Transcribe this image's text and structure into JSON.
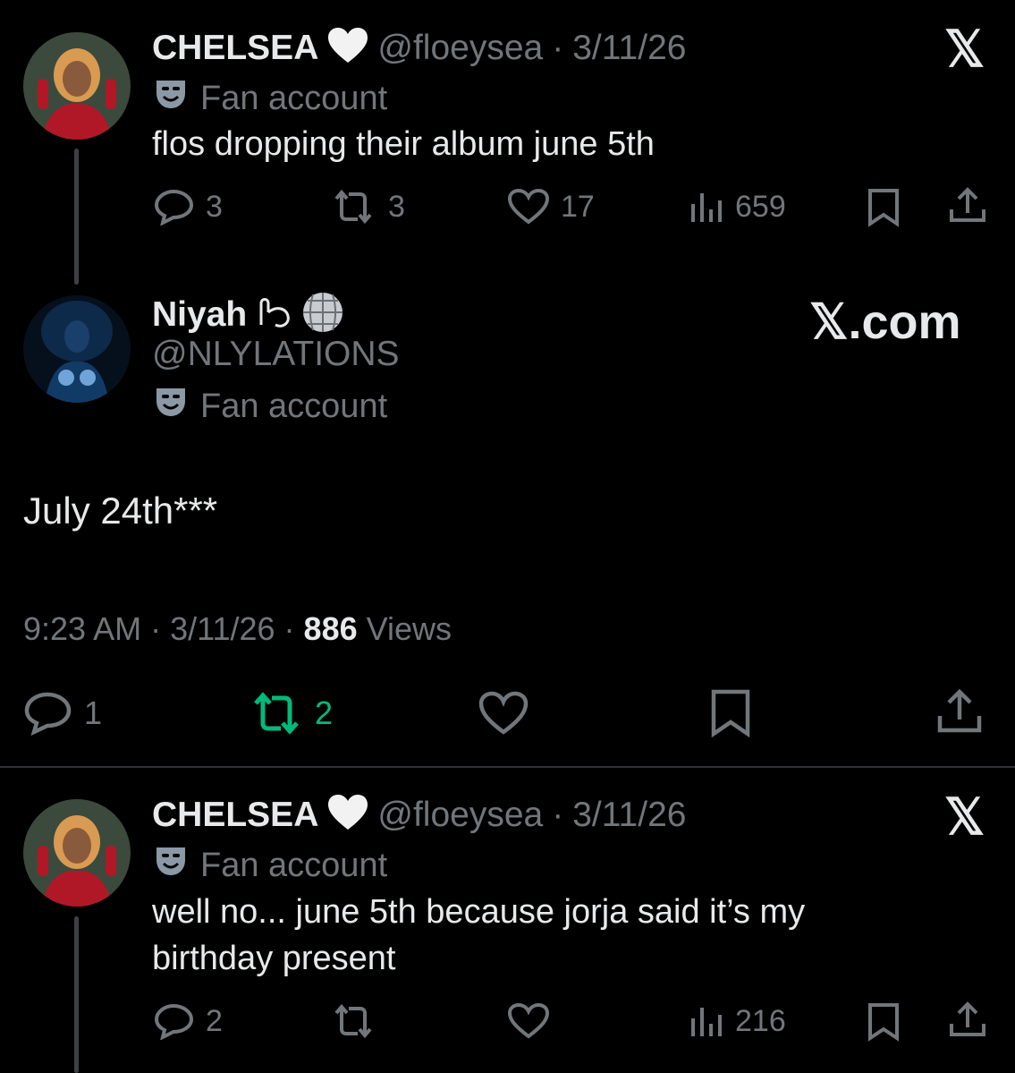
{
  "tweet1": {
    "display_name": "CHELSEA",
    "name_emoji": "white-heart",
    "handle": "@floeysea",
    "separator": "·",
    "date": "3/11/26",
    "badge": "Fan account",
    "text": "flos dropping their album june 5th",
    "replies": "3",
    "retweets": "3",
    "likes": "17",
    "views": "659"
  },
  "main_tweet": {
    "display_name": "Niyah",
    "name_emoji": "wave-and-disco-ball",
    "handle": "@NLYLATIONS",
    "badge": "Fan account",
    "text": "July 24th***",
    "time": "9:23 AM",
    "sep1": "·",
    "date": "3/11/26",
    "sep2": "·",
    "views_count": "886",
    "views_label": "Views",
    "replies": "1",
    "retweets": "2",
    "watermark": "𝕏.com"
  },
  "tweet3": {
    "display_name": "CHELSEA",
    "name_emoji": "white-heart",
    "handle": "@floeysea",
    "separator": "·",
    "date": "3/11/26",
    "badge": "Fan account",
    "text_line1": "well no... june 5th because jorja said it’s my",
    "text_line2": "birthday present",
    "replies": "2",
    "views": "216"
  },
  "x_logo": "𝕏",
  "colors": {
    "bg": "#000000",
    "text": "#e7e9ea",
    "muted": "#71767b",
    "retweet_active": "#00ba7c",
    "divider": "#2f3336"
  }
}
